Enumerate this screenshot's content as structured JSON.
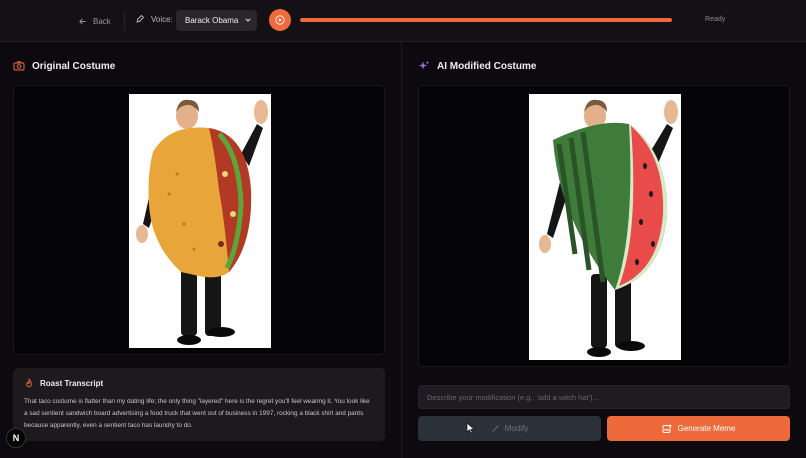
{
  "topbar": {
    "back_label": "Back",
    "voice_label": "Voice:",
    "voice_selected": "Barack Obama",
    "progress_percent": 100,
    "status": "Ready",
    "accent": "#ee6a3a"
  },
  "left": {
    "title": "Original Costume",
    "title_icon": "camera-icon",
    "image_alt": "Man in taco costume"
  },
  "right": {
    "title": "AI Modified Costume",
    "title_icon": "sparkles-icon",
    "image_alt": "Man in watermelon costume"
  },
  "transcript": {
    "title": "Roast Transcript",
    "icon": "flame-icon",
    "text": "That taco costume is flatter than my dating life; the only thing \"layered\" here is the regret you'll feel wearing it. You look like a sad sentient sandwich board advertising a food truck that went out of business in 1997, rocking a black shirt and pants because apparently, even a sentient taco has laundry to do."
  },
  "modify": {
    "placeholder": "Describe your modification (e.g., 'add a witch hat')...",
    "value": "",
    "modify_label": "Modify",
    "generate_label": "Generate Meme"
  },
  "badge": {
    "letter": "N"
  }
}
